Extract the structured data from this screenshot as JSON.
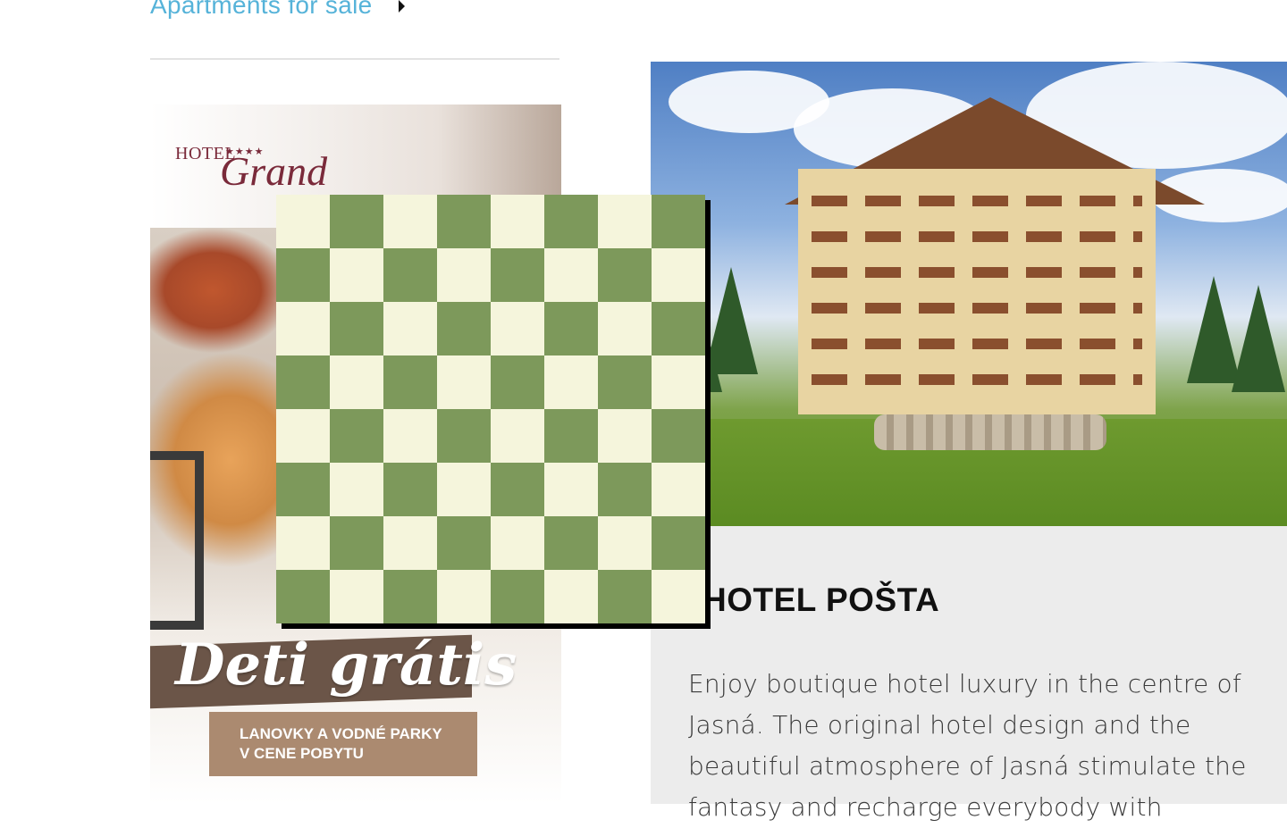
{
  "nav": {
    "apartments_link": "Apartments for sale",
    "caret_icon": "caret-right-icon"
  },
  "promo": {
    "logo_hotel": "HOTEL",
    "logo_stars": "★★★★",
    "logo_name": "Grand",
    "headline": "Deti grátis",
    "subline_1": "LANOVKY A VODNÉ PARKY",
    "subline_2": "V CENE POBYTU"
  },
  "board": {
    "rows": 8,
    "cols": 8,
    "light_color": "#f5f5dc",
    "dark_color": "#7d995b"
  },
  "card": {
    "title": "HOTEL POŠTA",
    "description": "Enjoy boutique hotel luxury in the centre of Jasná. The original hotel design and the beautiful atmosphere of Jasná stimulate the fantasy and recharge everybody with"
  }
}
